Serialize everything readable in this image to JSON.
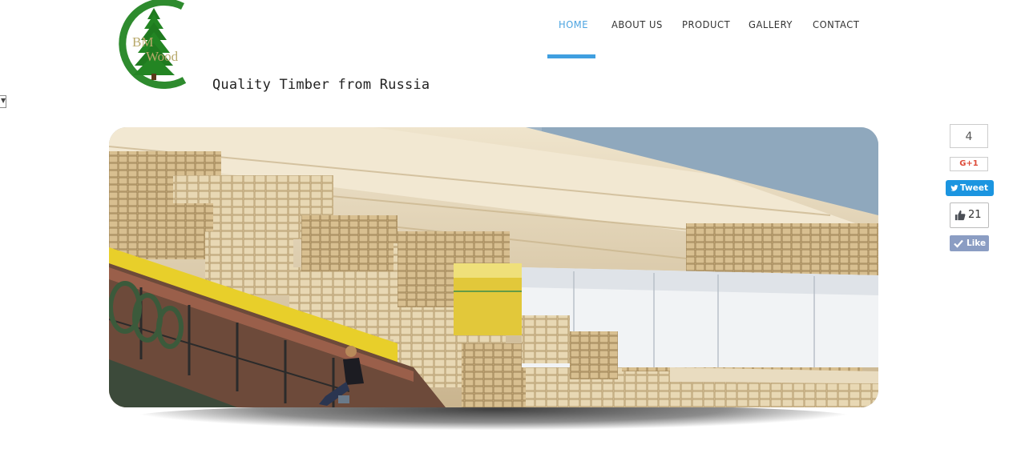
{
  "brand": {
    "logo_letters_1": "BM",
    "logo_letters_2": "Wood",
    "tagline": "Quality Timber from Russia"
  },
  "nav": {
    "items": [
      {
        "label": "HOME",
        "active": true
      },
      {
        "label": "ABOUT US",
        "active": false
      },
      {
        "label": "PRODUCT",
        "active": false
      },
      {
        "label": "GALLERY",
        "active": false
      },
      {
        "label": "CONTACT",
        "active": false
      }
    ]
  },
  "side_toggle": {
    "glyph": "▼"
  },
  "hero": {
    "subject": "timber-barge-photo"
  },
  "social": {
    "gplus_count": "4",
    "gplus_label": "G+1",
    "tweet_label": "Tweet",
    "fb_count": "21",
    "fb_like_label": "Like"
  },
  "colors": {
    "accent": "#3f9fe0",
    "nav_active": "#4aa3e0",
    "logo_green": "#2e8b2e",
    "tweet_blue": "#1b95e0",
    "fb_blue": "#8b9dc3"
  }
}
